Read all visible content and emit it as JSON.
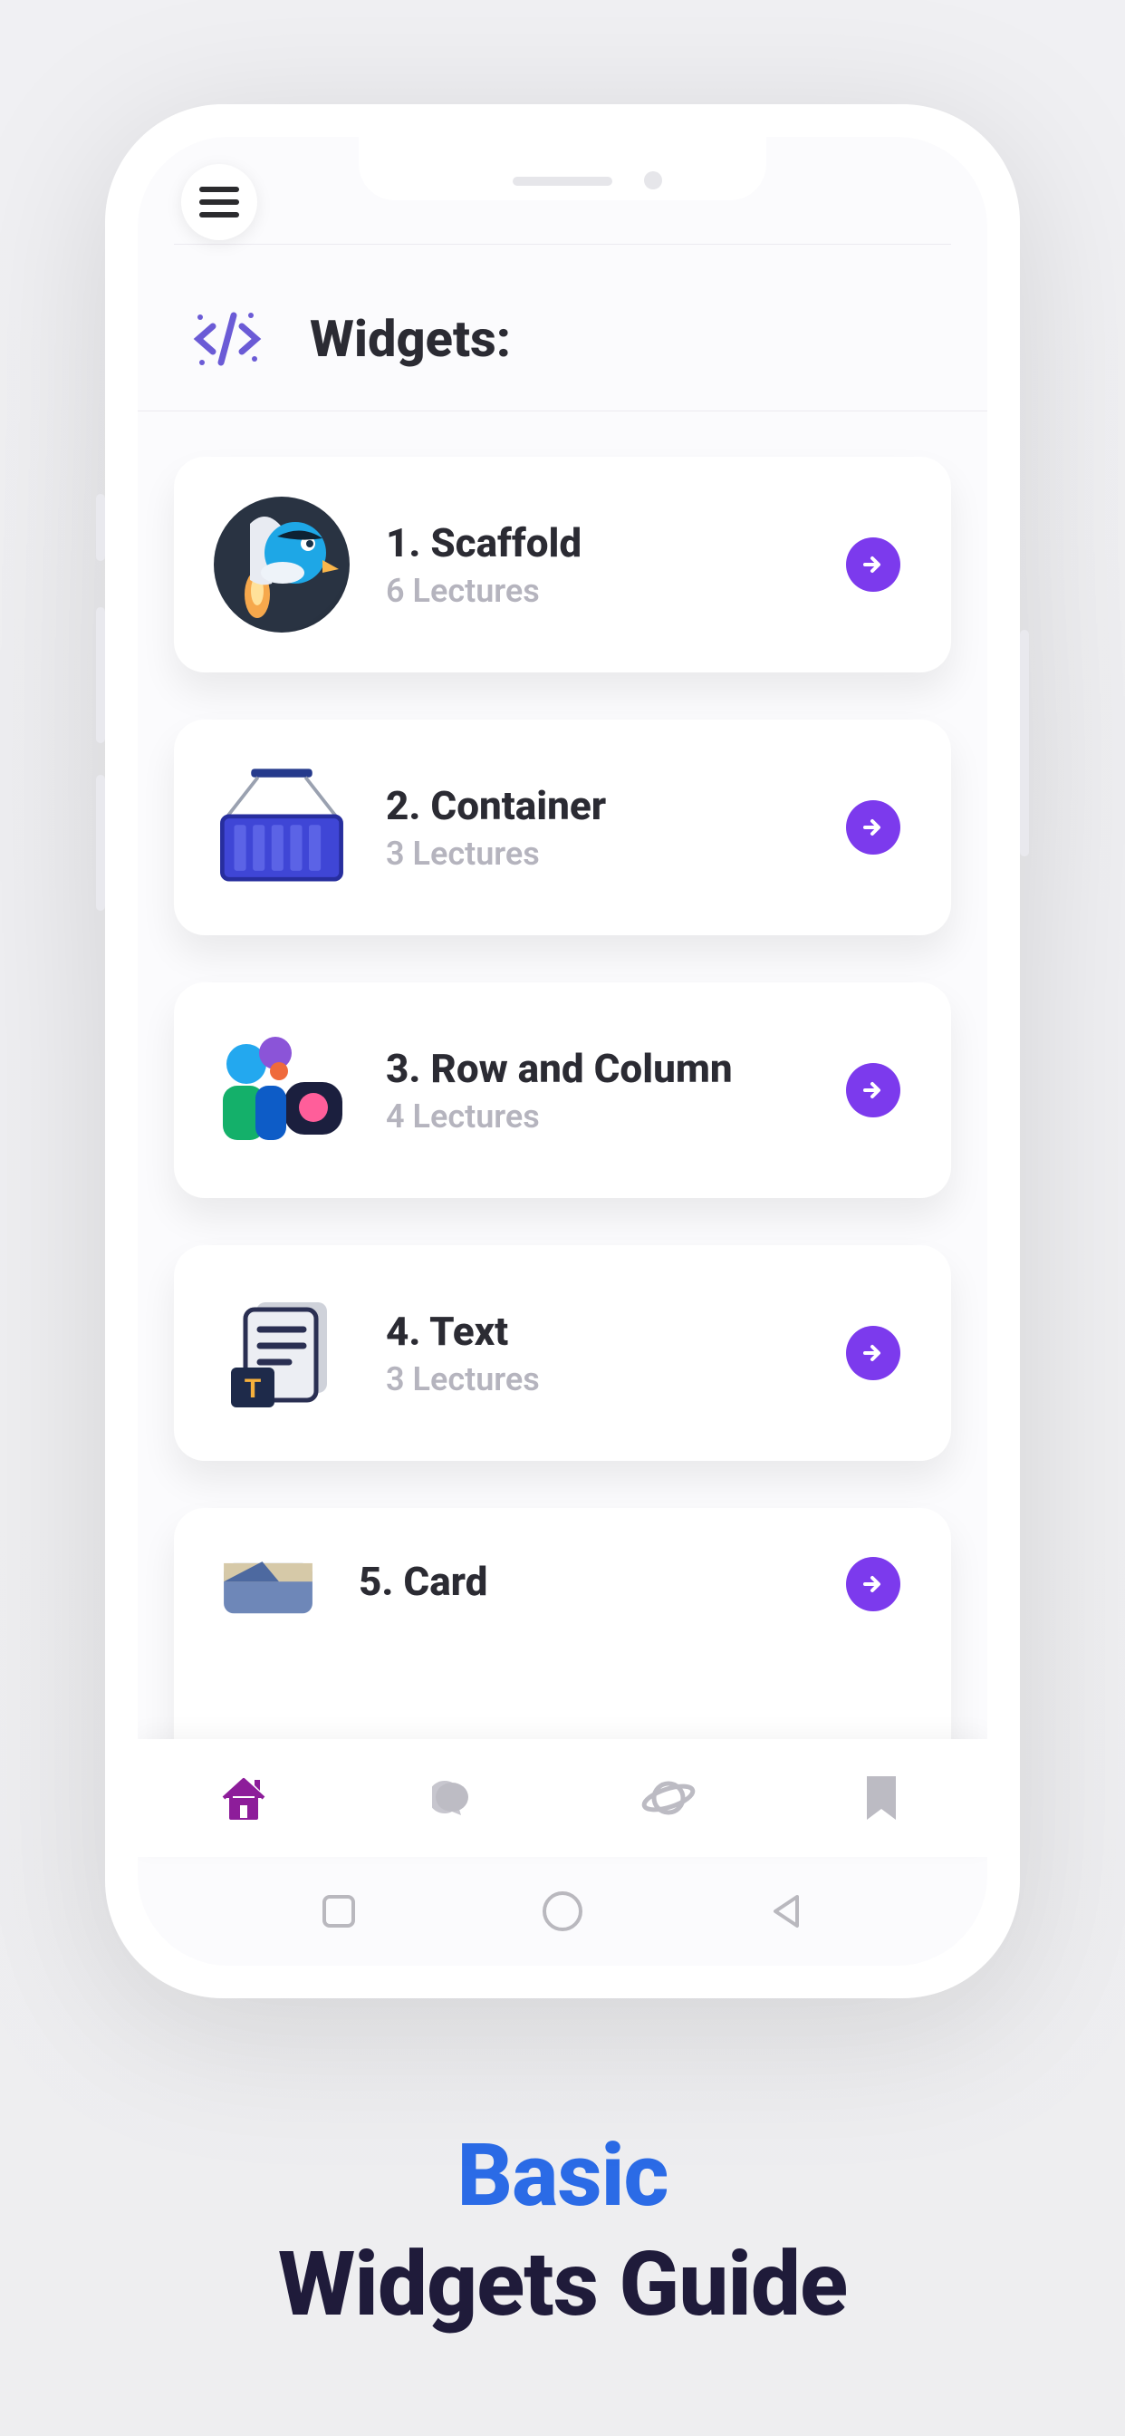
{
  "section": {
    "title": "Widgets:"
  },
  "items": [
    {
      "title": "1. Scaffold",
      "subtitle": "6 Lectures"
    },
    {
      "title": "2. Container",
      "subtitle": "3 Lectures"
    },
    {
      "title": "3. Row and Column",
      "subtitle": "4 Lectures"
    },
    {
      "title": "4. Text",
      "subtitle": "3 Lectures"
    },
    {
      "title": "5. Card",
      "subtitle": ""
    }
  ],
  "caption": {
    "line1": "Basic",
    "line2": "Widgets Guide"
  }
}
